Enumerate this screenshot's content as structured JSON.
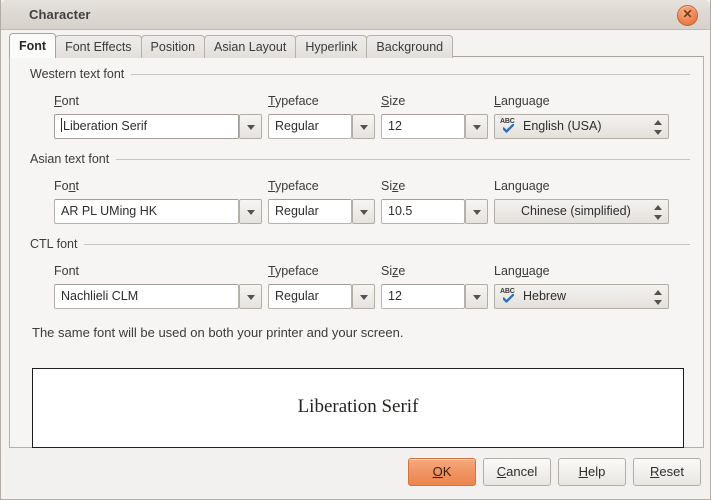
{
  "window": {
    "title": "Character",
    "close_icon": "close-icon",
    "close_glyph": "✕"
  },
  "tabs": [
    {
      "label": "Font",
      "active": true
    },
    {
      "label": "Font Effects",
      "active": false
    },
    {
      "label": "Position",
      "active": false
    },
    {
      "label": "Asian Layout",
      "active": false
    },
    {
      "label": "Hyperlink",
      "active": false
    },
    {
      "label": "Background",
      "active": false
    }
  ],
  "groups": {
    "western": {
      "title": "Western text font",
      "font_label": "Font",
      "font_label_pre": "F",
      "font_label_post": "ont",
      "typeface_label_pre": "T",
      "typeface_label_post": "ypeface",
      "size_label_pre": "S",
      "size_label_post": "ize",
      "language_label_pre": "L",
      "language_label_post": "anguage",
      "font_value": "Liberation Serif",
      "typeface_value": "Regular",
      "size_value": "12",
      "language_value": "English (USA)",
      "language_has_spellcheck_icon": true
    },
    "asian": {
      "title": "Asian text font",
      "font_label_pre": "Fo",
      "font_label_mid": "n",
      "font_label_post": "t",
      "typeface_label_pre": "T",
      "typeface_label_post": "ypeface",
      "size_label_pre": "Si",
      "size_label_mid": "z",
      "size_label_post": "e",
      "language_label_pre": "Lan",
      "language_label_mid": "g",
      "language_label_post": "uage",
      "font_value": "AR PL UMing HK",
      "typeface_value": "Regular",
      "size_value": "10.5",
      "language_value": "Chinese (simplified)",
      "language_has_spellcheck_icon": false
    },
    "ctl": {
      "title": "CTL font",
      "font_label": "Font",
      "typeface_label_pre": "T",
      "typeface_label_post": "ypeface",
      "size_label_pre": "Si",
      "size_label_mid": "z",
      "size_label_post": "e",
      "language_label_pre": "Lang",
      "language_label_mid": "u",
      "language_label_post": "age",
      "font_value": "Nachlieli CLM",
      "typeface_value": "Regular",
      "size_value": "12",
      "language_value": "Hebrew",
      "language_has_spellcheck_icon": true
    }
  },
  "info_text": "The same font will be used on both your printer and your screen.",
  "preview": {
    "text": "Liberation Serif"
  },
  "buttons": {
    "ok": {
      "pre": "O",
      "mid": "K",
      "post": ""
    },
    "cancel": {
      "pre": "C",
      "mid": "",
      "post": "ancel"
    },
    "help": {
      "pre": "H",
      "mid": "",
      "post": "elp"
    },
    "reset": {
      "pre": "R",
      "mid": "",
      "post": "eset"
    }
  },
  "colors": {
    "accent_orange": "#ef9261",
    "dialog_bg": "#f6f5f4",
    "titlebar": "#ddd8d2",
    "text": "#3c3b39"
  }
}
